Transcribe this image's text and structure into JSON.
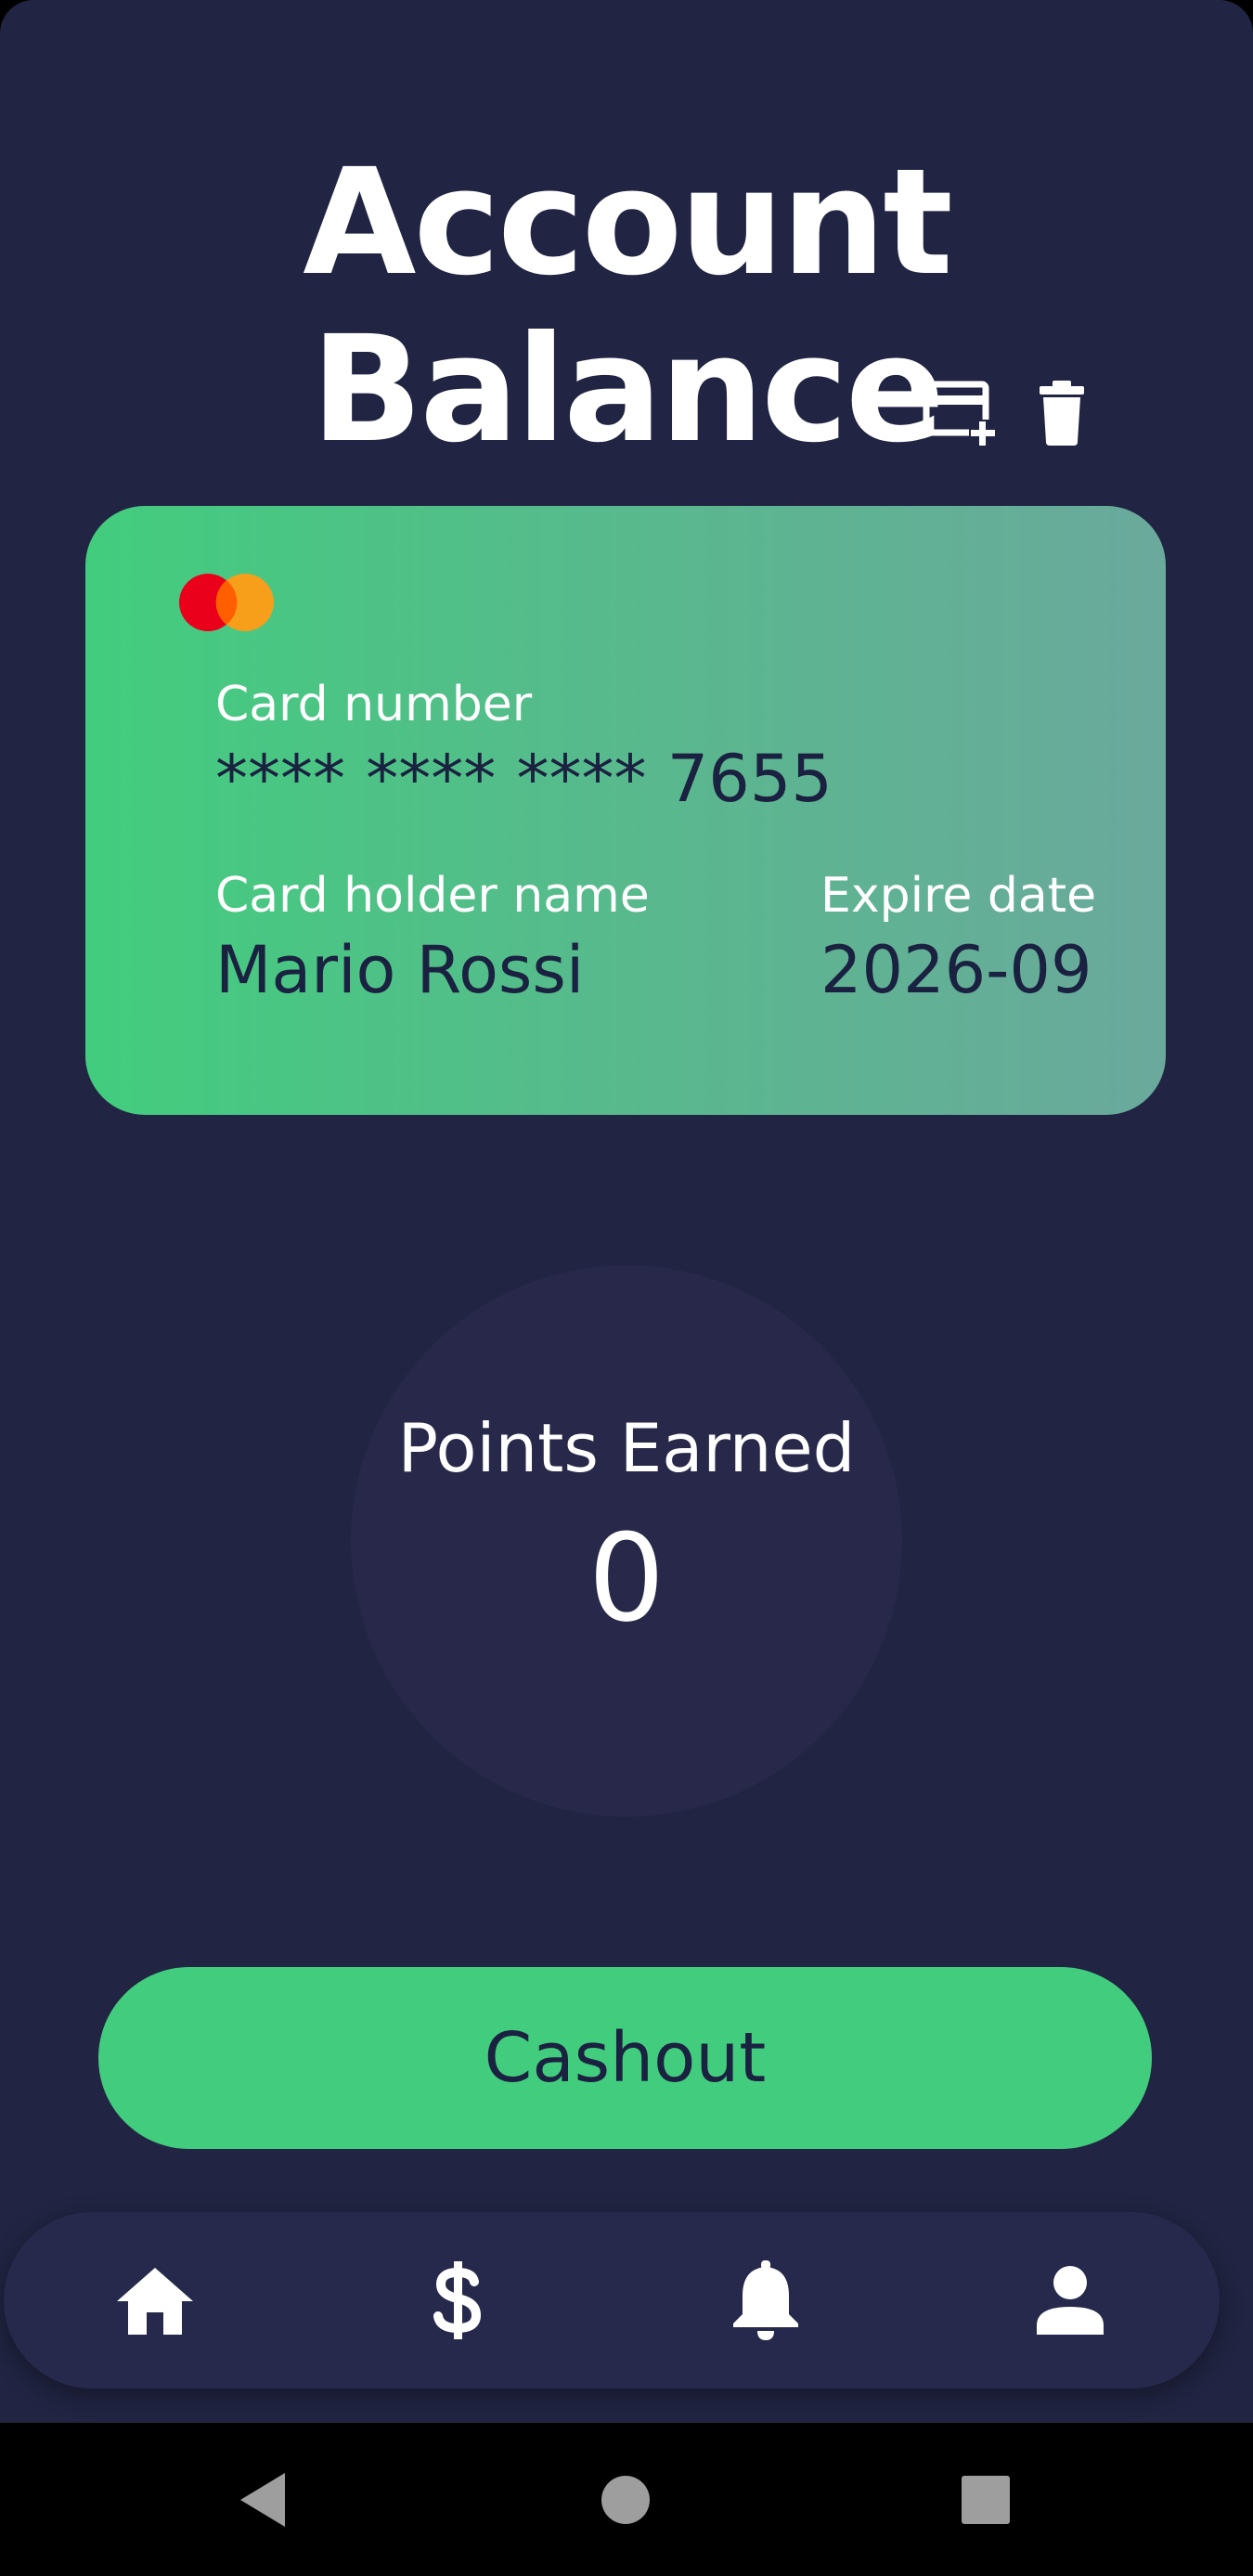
{
  "header": {
    "title": "Account Balance",
    "actions": [
      {
        "name": "add-card",
        "icon": "add-card-icon"
      },
      {
        "name": "delete-card",
        "icon": "trash-icon"
      }
    ]
  },
  "card": {
    "brand_icon": "mastercard-logo",
    "number_label": "Card number",
    "number_value": "**** **** **** 7655",
    "holder_label": "Card holder name",
    "holder_value": "Mario Rossi",
    "expire_label": "Expire date",
    "expire_value": "2026-09",
    "gradient": [
      "#42cd7e",
      "#6aa99c"
    ]
  },
  "points": {
    "label": "Points Earned",
    "value": "0"
  },
  "cashout": {
    "label": "Cashout"
  },
  "bottom_nav": {
    "items": [
      {
        "name": "home",
        "icon": "home-icon"
      },
      {
        "name": "money",
        "icon": "dollar-icon"
      },
      {
        "name": "notifications",
        "icon": "bell-icon"
      },
      {
        "name": "profile",
        "icon": "person-icon"
      }
    ]
  },
  "system_nav": {
    "items": [
      {
        "name": "back",
        "icon": "back-triangle-icon"
      },
      {
        "name": "home",
        "icon": "home-circle-icon"
      },
      {
        "name": "recents",
        "icon": "recents-square-icon"
      }
    ]
  },
  "colors": {
    "background": "#212442",
    "accent": "#42cd7e",
    "dark_text": "#1b2140",
    "surface": "#26294b",
    "circle": "#28294a"
  }
}
